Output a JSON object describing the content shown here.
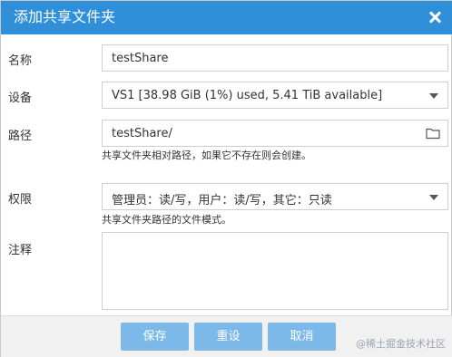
{
  "dialog": {
    "title": "添加共享文件夹"
  },
  "form": {
    "name_label": "名称",
    "name_value": "testShare",
    "device_label": "设备",
    "device_value": "VS1 [38.98 GiB (1%) used, 5.41 TiB available]",
    "path_label": "路径",
    "path_value": "testShare/",
    "path_hint": "共享文件夹相对路径，如果它不存在则会创建。",
    "perm_label": "权限",
    "perm_value": "管理员：读/写，用户：读/写，其它：只读",
    "perm_hint": "共享文件夹路径的文件模式。",
    "comment_label": "注释",
    "comment_value": ""
  },
  "buttons": {
    "save": "保存",
    "reset": "重设",
    "cancel": "取消"
  },
  "watermark": "@稀土掘金技术社区",
  "icons": {
    "close": "close-icon",
    "dropdown": "chevron-down-icon",
    "folder": "folder-icon"
  },
  "colors": {
    "titlebar": "#2f8fd8",
    "button": "#7cb9e8",
    "footer": "#f1f1f1"
  }
}
